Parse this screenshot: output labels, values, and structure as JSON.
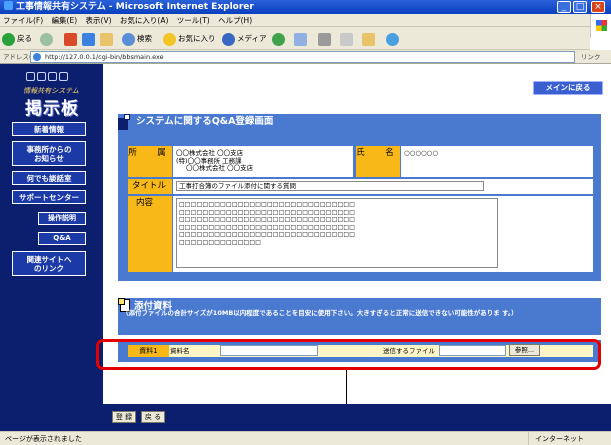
{
  "window": {
    "title": "工事情報共有システム - Microsoft Internet Explorer",
    "min": "_",
    "max": "□",
    "close": "×"
  },
  "menu": [
    "ファイル(F)",
    "編集(E)",
    "表示(V)",
    "お気に入り(A)",
    "ツール(T)",
    "ヘルプ(H)"
  ],
  "toolbar": {
    "back": "戻る",
    "search": "検索",
    "favorites": "お気に入り",
    "media": "メディア"
  },
  "address": {
    "label": "アドレス(D)",
    "url": "http://127.0.0.1/cgi-bin/bbsmain.exe",
    "links": "リンク"
  },
  "logo": {
    "sub": "情報共有システム",
    "main": "掲示板"
  },
  "nav": {
    "news": "新着情報",
    "office_notice_1": "事務所からの",
    "office_notice_2": "お知らせ",
    "forum": "何でも談話室",
    "support": "サポートセンター",
    "manual": "操作説明",
    "qa": "Q&A",
    "links_1": "関連サイトへ",
    "links_2": "のリンク"
  },
  "header": {
    "main_return": "メインに戻る",
    "page_title": "システムに関するQ&A登録画面"
  },
  "form": {
    "affiliation_label": "所　属",
    "affiliation_lines": [
      "〇〇株式会社 〇〇支店",
      "(特)〇〇事務所 工務課",
      "〇〇株式会社 〇〇支店"
    ],
    "name_label": "氏　名",
    "name_value": "○○○○○○",
    "title_label": "タイトル",
    "title_value": "工事打合簿のファイル添付に関する質問",
    "content_label": "内容",
    "content_lines": [
      "□□□□□□□□□□□□□□□□□□□□□□□□□□□□□□",
      "□□□□□□□□□□□□□□□□□□□□□□□□□□□□□□",
      "□□□□□□□□□□□□□□□□□□□□□□□□□□□□□□",
      "□□□□□□□□□□□□□□□□□□□□□□□□□□□□□□",
      "□□□□□□□□□□□□□□□□□□□□□□□□□□□□□□",
      "□□□□□□□□□□□□□□"
    ]
  },
  "attachments": {
    "title": "添付資料",
    "note": "（添付ファイルの合計サイズが10MB以内程度であることを目安に使用下さい。大きすぎると正常に送信できない可能性がありま す。）",
    "row_label": "資料1",
    "name_label": "資料名",
    "file_label": "送信するファイル",
    "browse": "参照..."
  },
  "footer": {
    "register": "登 録",
    "back": "戻 る"
  },
  "status": {
    "left": "ページが表示されました",
    "zone": "インターネット"
  }
}
